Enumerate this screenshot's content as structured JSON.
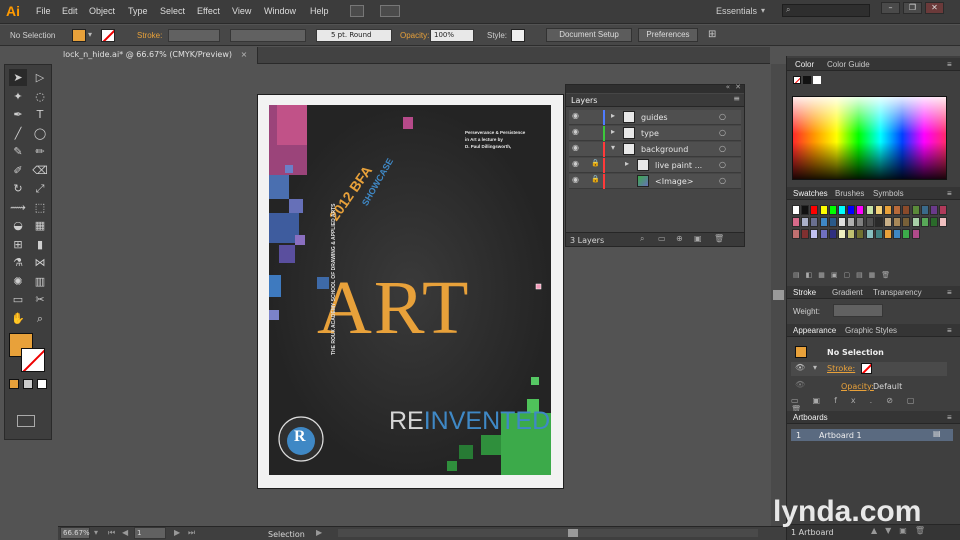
{
  "app": {
    "logo": "Ai"
  },
  "menu": {
    "items": [
      "File",
      "Edit",
      "Object",
      "Type",
      "Select",
      "Effect",
      "View",
      "Window",
      "Help"
    ]
  },
  "workspace": {
    "label": "Essentials"
  },
  "control_bar": {
    "selection_label": "No Selection",
    "stroke_label": "Stroke:",
    "brush_value": "5 pt. Round",
    "opacity_label": "Opacity:",
    "opacity_value": "100%",
    "style_label": "Style:",
    "document_setup": "Document Setup",
    "preferences": "Preferences"
  },
  "document_tab": {
    "title": "lock_n_hide.ai* @ 66.67% (CMYK/Preview)",
    "close": "×"
  },
  "poster": {
    "art": "ART",
    "re": "RE",
    "invented": "INVENTED",
    "bfa": "2012 BFA",
    "showcase": "SHOWCASE",
    "school": "THE ROUX ACADEMY SCHOOL OF DRAWING & APPLIED ARTS",
    "lecture_title": "Perseverance & Persistence",
    "lecture_sub": "in Art a lecture by",
    "lecture_author": "D. Paul Dillingsworth,",
    "seal_letter": "R"
  },
  "layers_panel": {
    "title": "Layers",
    "count": "3 Layers",
    "rows": [
      {
        "name": "guides",
        "color": "#4f7cff"
      },
      {
        "name": "type",
        "color": "#3cc83c"
      },
      {
        "name": "background",
        "color": "#ff3a3a"
      },
      {
        "name": "live paint ...",
        "color": "#ff3a3a"
      },
      {
        "name": "<Image>",
        "color": "#ff3a3a"
      }
    ]
  },
  "color_panel": {
    "tab1": "Color",
    "tab2": "Color Guide"
  },
  "swatches_panel": {
    "tab1": "Swatches",
    "tab2": "Brushes",
    "tab3": "Symbols"
  },
  "stroke_panel": {
    "tab1": "Stroke",
    "tab2": "Gradient",
    "tab3": "Transparency",
    "weight_label": "Weight:"
  },
  "appearance_panel": {
    "tab1": "Appearance",
    "tab2": "Graphic Styles",
    "selection": "No Selection",
    "stroke_label": "Stroke:",
    "opacity_label": "Opacity:",
    "opacity_value": "Default"
  },
  "artboards_panel": {
    "title": "Artboards",
    "row_index": "1",
    "row_name": "Artboard 1",
    "count": "1 Artboard"
  },
  "status_bar": {
    "zoom": "66.67%",
    "page": "1",
    "tool": "Selection"
  },
  "watermark": "lynda.com",
  "colors": {
    "accent": "#e8a13a",
    "blue": "#3f88c5",
    "panel": "#464646"
  }
}
